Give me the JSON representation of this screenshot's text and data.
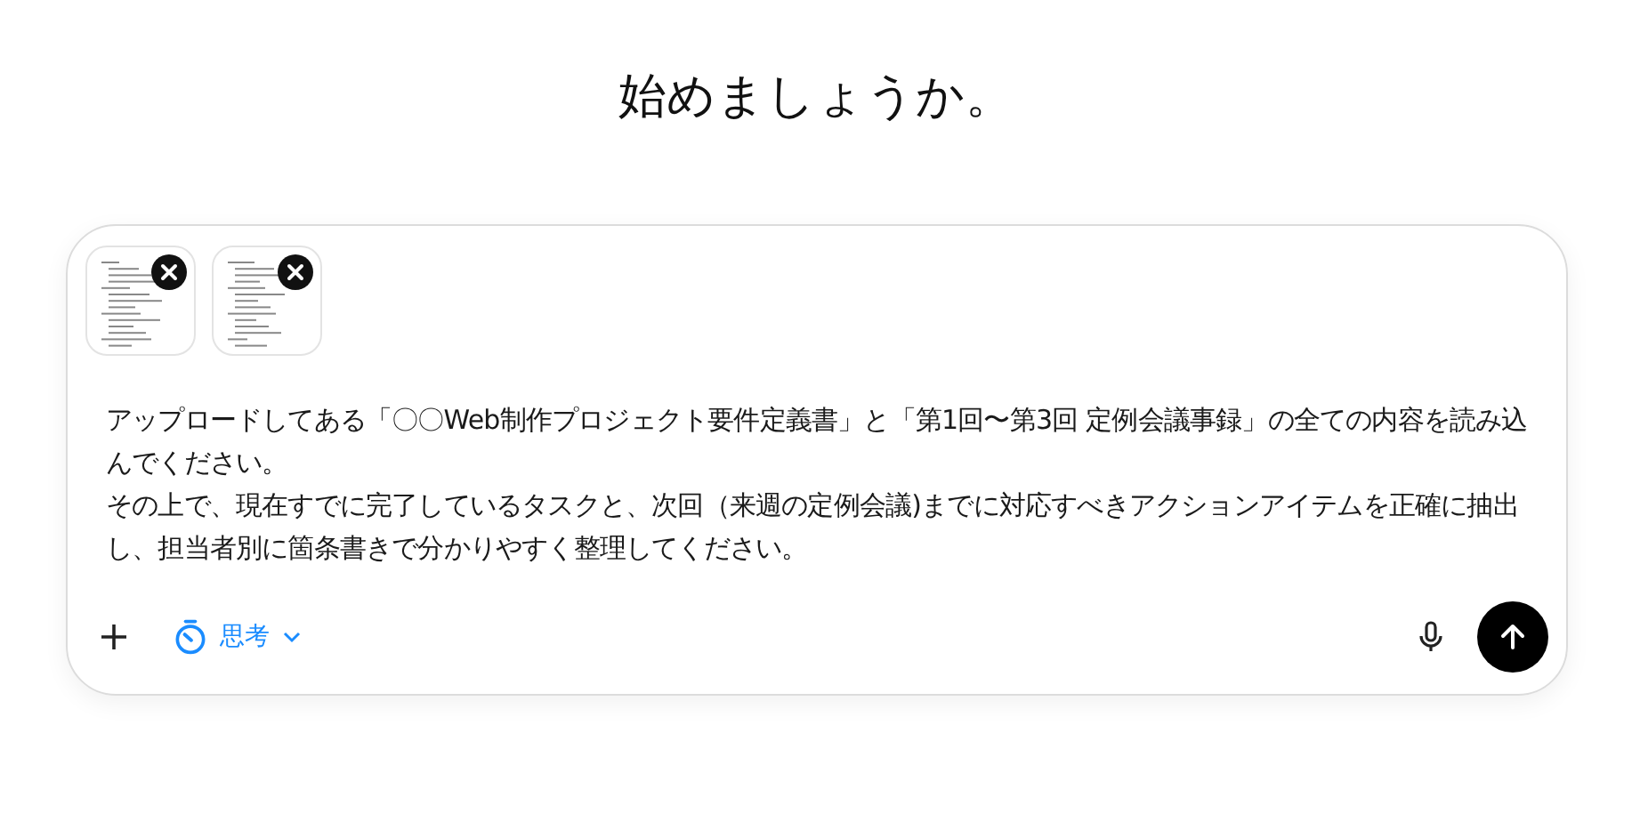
{
  "heading": "始めましょうか。",
  "composer": {
    "attachments": [
      {
        "kind": "document"
      },
      {
        "kind": "document"
      }
    ],
    "paragraphs": [
      "アップロードしてある「〇〇Web制作プロジェクト要件定義書」と「第1回〜第3回 定例会議事録」の全ての内容を読み込んでください。",
      "その上で、現在すでに完了しているタスクと、次回（来週の定例会議)までに対応すべきアクションアイテムを正確に抽出し、担当者別に箇条書きで分かりやすく整理してください。"
    ],
    "mode": "思考"
  }
}
